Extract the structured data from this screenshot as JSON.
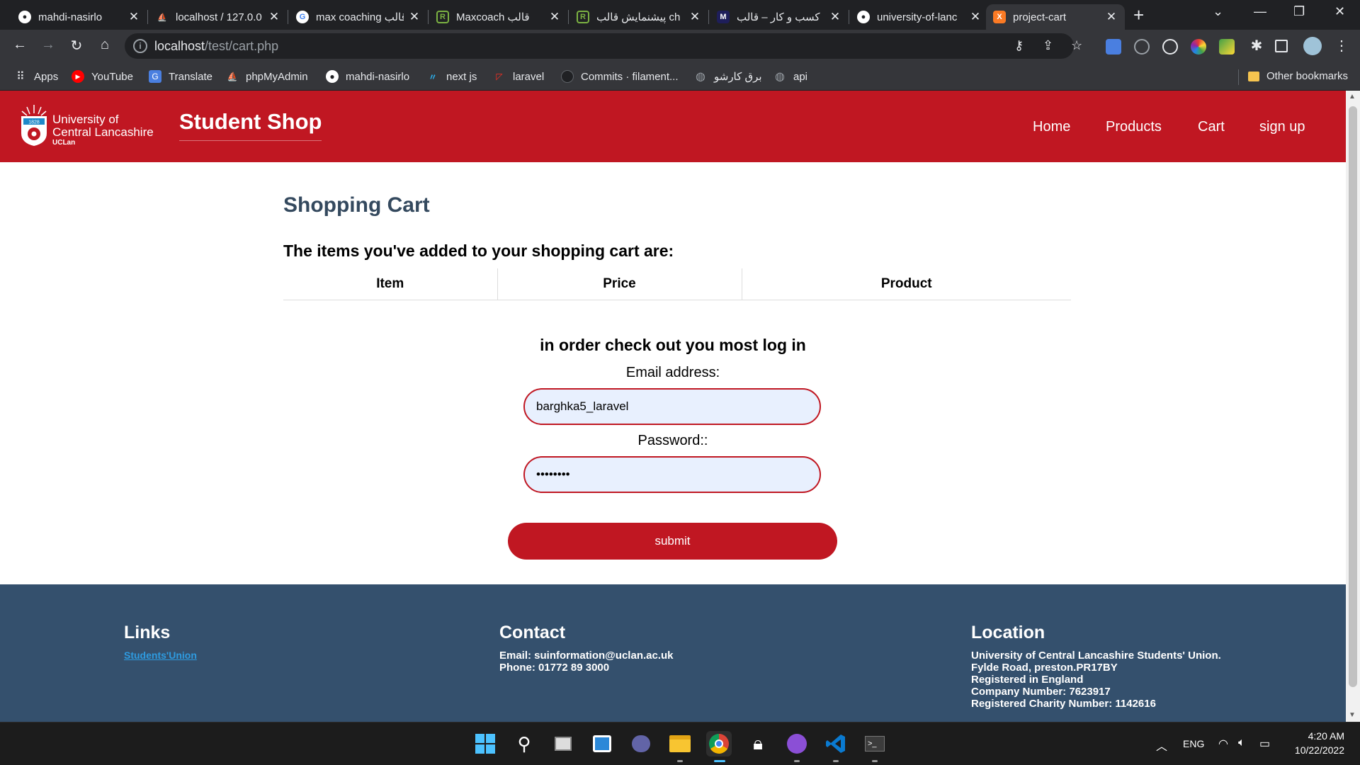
{
  "browser": {
    "tabs": [
      {
        "title": "mahdi-nasirlo",
        "icon": "github-icon",
        "active": false
      },
      {
        "title": "localhost / 127.0.0",
        "icon": "phpmyadmin-icon",
        "active": false
      },
      {
        "title": "max coaching قالب",
        "icon": "google-icon",
        "active": false
      },
      {
        "title": "Maxcoach قالب",
        "icon": "rtl-theme-icon",
        "active": false
      },
      {
        "title": "پیشنمایش قالب ch",
        "icon": "rtl-theme-icon",
        "active": false
      },
      {
        "title": "کسب و کار – قالب",
        "icon": "m-site-icon",
        "active": false
      },
      {
        "title": "university-of-lanc",
        "icon": "github-icon",
        "active": false
      },
      {
        "title": "project-cart",
        "icon": "xampp-icon",
        "active": true
      }
    ],
    "url_host": "localhost",
    "url_path": "/test/cart.php",
    "bookmarks": [
      {
        "label": "Apps",
        "icon": "apps-grid-icon"
      },
      {
        "label": "YouTube",
        "icon": "youtube-icon"
      },
      {
        "label": "Translate",
        "icon": "translate-icon"
      },
      {
        "label": "phpMyAdmin",
        "icon": "phpmyadmin-icon"
      },
      {
        "label": "mahdi-nasirlo",
        "icon": "github-icon"
      },
      {
        "label": "next js",
        "icon": "nextjs-icon"
      },
      {
        "label": "laravel",
        "icon": "laravel-icon"
      },
      {
        "label": "Commits · filament...",
        "icon": "github-icon"
      },
      {
        "label": "برق کارشو",
        "icon": "globe-icon"
      },
      {
        "label": "api",
        "icon": "globe-icon"
      }
    ],
    "other_bookmarks": "Other bookmarks"
  },
  "site": {
    "logo_line1": "University of",
    "logo_line2": "Central Lancashire",
    "logo_line3": "UCLan",
    "logo_year": "1828",
    "shop_title": "Student Shop",
    "nav": [
      "Home",
      "Products",
      "Cart",
      "sign up"
    ]
  },
  "cart": {
    "heading": "Shopping Cart",
    "intro": "The items you've added to your shopping cart are:",
    "columns": [
      "Item",
      "Price",
      "Product"
    ]
  },
  "login": {
    "note": "in order check out you most log in",
    "email_label": "Email address:",
    "email_value": "barghka5_laravel",
    "password_label": "Password::",
    "password_value": "••••••••",
    "submit_label": "submit"
  },
  "footer": {
    "links_heading": "Links",
    "links": [
      "Students'Union"
    ],
    "contact_heading": "Contact",
    "contact_lines": [
      "Email: suinformation@uclan.ac.uk",
      "Phone: 01772 89 3000"
    ],
    "location_heading": "Location",
    "location_lines": [
      "University of Central Lancashire Students' Union.",
      "Fylde Road, preston.PR17BY",
      "Registered in England",
      "Company Number: 7623917",
      "Registered Charity Number: 1142616"
    ]
  },
  "taskbar": {
    "language": "ENG",
    "time": "4:20 AM",
    "date": "10/22/2022"
  },
  "colors": {
    "brand_red": "#c01722",
    "footer_blue": "#34506d",
    "heading_slate": "#34495e"
  }
}
